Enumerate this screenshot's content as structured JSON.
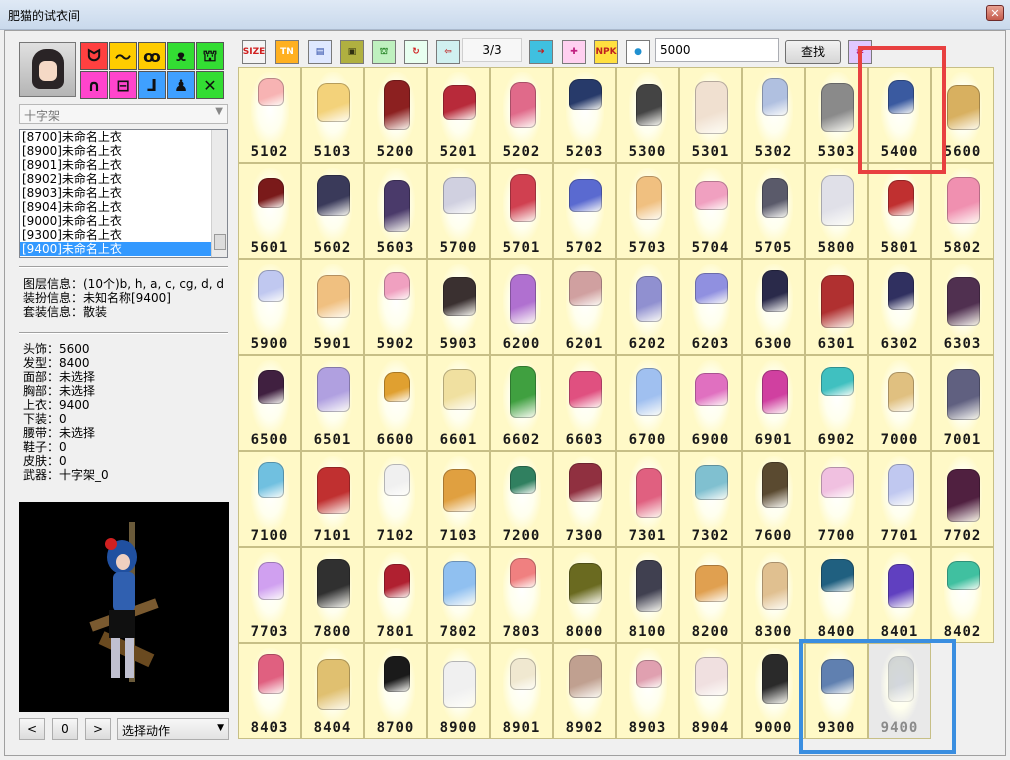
{
  "window": {
    "title": "肥猫的试衣间",
    "close_glyph": "✕"
  },
  "categories": [
    {
      "name": "cat-ears-icon",
      "glyph": "ᗢ",
      "color": "#ff4040"
    },
    {
      "name": "hair-icon",
      "glyph": "〜",
      "color": "#ffcc00"
    },
    {
      "name": "glasses-icon",
      "glyph": "ꝏ",
      "color": "#ffcc00"
    },
    {
      "name": "wings-icon",
      "glyph": "ᴥ",
      "color": "#33dd33"
    },
    {
      "name": "shirt-icon",
      "glyph": "⛫",
      "color": "#33dd33"
    },
    {
      "name": "pants-icon",
      "glyph": "∩",
      "color": "#ff44cc"
    },
    {
      "name": "belt-icon",
      "glyph": "⊟",
      "color": "#ff44cc"
    },
    {
      "name": "shoes-icon",
      "glyph": "ᒧ",
      "color": "#3fa0ff"
    },
    {
      "name": "body-icon",
      "glyph": "♟",
      "color": "#3fa0ff"
    },
    {
      "name": "weapon-icon",
      "glyph": "✕",
      "color": "#33dd33"
    }
  ],
  "weapon_combo": "十字架",
  "item_list": [
    "[8700]未命名上衣",
    "[8900]未命名上衣",
    "[8901]未命名上衣",
    "[8902]未命名上衣",
    "[8903]未命名上衣",
    "[8904]未命名上衣",
    "[9000]未命名上衣",
    "[9300]未命名上衣",
    "[9400]未命名上衣"
  ],
  "selected_index": 8,
  "layer_info": [
    "图层信息：(10个)b, h, a, c, cg, d, d",
    "装扮信息：未知名称[9400]",
    "套装信息：散装"
  ],
  "equip_info": [
    "头饰：5600",
    "发型：8400",
    "面部：未选择",
    "胸部：未选择",
    "上衣：9400",
    "下装：0",
    "腰带：未选择",
    "鞋子：0",
    "皮肤：0",
    "武器：十字架_0"
  ],
  "nav": {
    "prev": "<",
    "index": "0",
    "next": ">"
  },
  "action_combo": "选择动作",
  "toolbar": [
    {
      "name": "size-button",
      "text": "SIZE",
      "bg": "#f4f4f4",
      "fg": "#d02020"
    },
    {
      "name": "tn-button",
      "text": "TN",
      "bg": "#ffb020",
      "fg": "#ffffff"
    },
    {
      "name": "book-button",
      "text": "▤",
      "bg": "#dfe8ff",
      "fg": "#2040a0"
    },
    {
      "name": "frame-button",
      "text": "▣",
      "bg": "#b0b040",
      "fg": "#303010"
    },
    {
      "name": "shirt-swap-button",
      "text": "⛫",
      "bg": "#bff0bf",
      "fg": "#208020"
    },
    {
      "name": "refresh-button",
      "text": "↻",
      "bg": "#e8fff0",
      "fg": "#d02020"
    },
    {
      "name": "export-button",
      "text": "⇦",
      "bg": "#d0f0f0",
      "fg": "#c03030"
    },
    {
      "name": "next-page-button",
      "text": "➜",
      "bg": "#3fc0e0",
      "fg": "#c02020"
    },
    {
      "name": "gift-button",
      "text": "✚",
      "bg": "#ffd0f0",
      "fg": "#c02080"
    },
    {
      "name": "npk-button",
      "text": "NPK",
      "bg": "#ffe040",
      "fg": "#c02020"
    },
    {
      "name": "globe-button",
      "text": "●",
      "bg": "#ffffff",
      "fg": "#2090d0"
    }
  ],
  "page_indicator": "3/3",
  "search_value": "5000",
  "find_label": "查找",
  "items": [
    "5102",
    "5103",
    "5200",
    "5201",
    "5202",
    "5203",
    "5300",
    "5301",
    "5302",
    "5303",
    "5400",
    "5600",
    "5601",
    "5602",
    "5603",
    "5700",
    "5701",
    "5702",
    "5703",
    "5704",
    "5705",
    "5800",
    "5801",
    "5802",
    "5900",
    "5901",
    "5902",
    "5903",
    "6200",
    "6201",
    "6202",
    "6203",
    "6300",
    "6301",
    "6302",
    "6303",
    "6500",
    "6501",
    "6600",
    "6601",
    "6602",
    "6603",
    "6700",
    "6900",
    "6901",
    "6902",
    "7000",
    "7001",
    "7100",
    "7101",
    "7102",
    "7103",
    "7200",
    "7300",
    "7301",
    "7302",
    "7600",
    "7700",
    "7701",
    "7702",
    "7703",
    "7800",
    "7801",
    "7802",
    "7803",
    "8000",
    "8100",
    "8200",
    "8300",
    "8400",
    "8401",
    "8402",
    "8403",
    "8404",
    "8700",
    "8900",
    "8901",
    "8902",
    "8903",
    "8904",
    "9000",
    "9300",
    "9400"
  ],
  "item_colors": [
    "#f7b3b3",
    "#f3d27a",
    "#8c2020",
    "#b82a3a",
    "#e06a8a",
    "#273a6a",
    "#444444",
    "#f0e0d0",
    "#b0c0e0",
    "#8a8a8a",
    "#3a5aa0",
    "#d8b060",
    "#7a1a1a",
    "#3a3a5a",
    "#4a3a6a",
    "#d0d0e0",
    "#d04050",
    "#5a6ad0",
    "#f0c080",
    "#f0a0c0",
    "#5a5a6a",
    "#e0e0e8",
    "#c03030",
    "#f090b0",
    "#c0c8f0",
    "#f0c080",
    "#f0a0c0",
    "#3a3030",
    "#b070d0",
    "#d0a0a0",
    "#9090d0",
    "#9090e0",
    "#2a2a4a",
    "#b03030",
    "#303060",
    "#503050",
    "#402040",
    "#b0a0e0",
    "#e0a030",
    "#f0e0a0",
    "#40a040",
    "#e05080",
    "#a0c0f0",
    "#e070c0",
    "#d040a0",
    "#40c0c0",
    "#e0c080",
    "#606080",
    "#70c0e0",
    "#c03030",
    "#f0f0f0",
    "#e0a040",
    "#308060",
    "#903040",
    "#e06080",
    "#80c0d0",
    "#5a4a30",
    "#f0c0e0",
    "#c0c8f0",
    "#502040",
    "#d0a0f0",
    "#303030",
    "#b02030",
    "#90c0f0",
    "#f08080",
    "#6a6a20",
    "#404050",
    "#e0a050",
    "#e0c090",
    "#206080",
    "#6040c0",
    "#40c0a0",
    "#e06080",
    "#e0c070",
    "#1a1a1a",
    "#f0f0f0",
    "#f0e8d0",
    "#c0a090",
    "#e0a0b0",
    "#f0e0e0",
    "#2a2a2a",
    "#6080b0",
    "#a0a8b8"
  ],
  "dimmed_item": "9400",
  "highlights": {
    "top": "#e84040",
    "bottom": "#3a8ee0"
  }
}
